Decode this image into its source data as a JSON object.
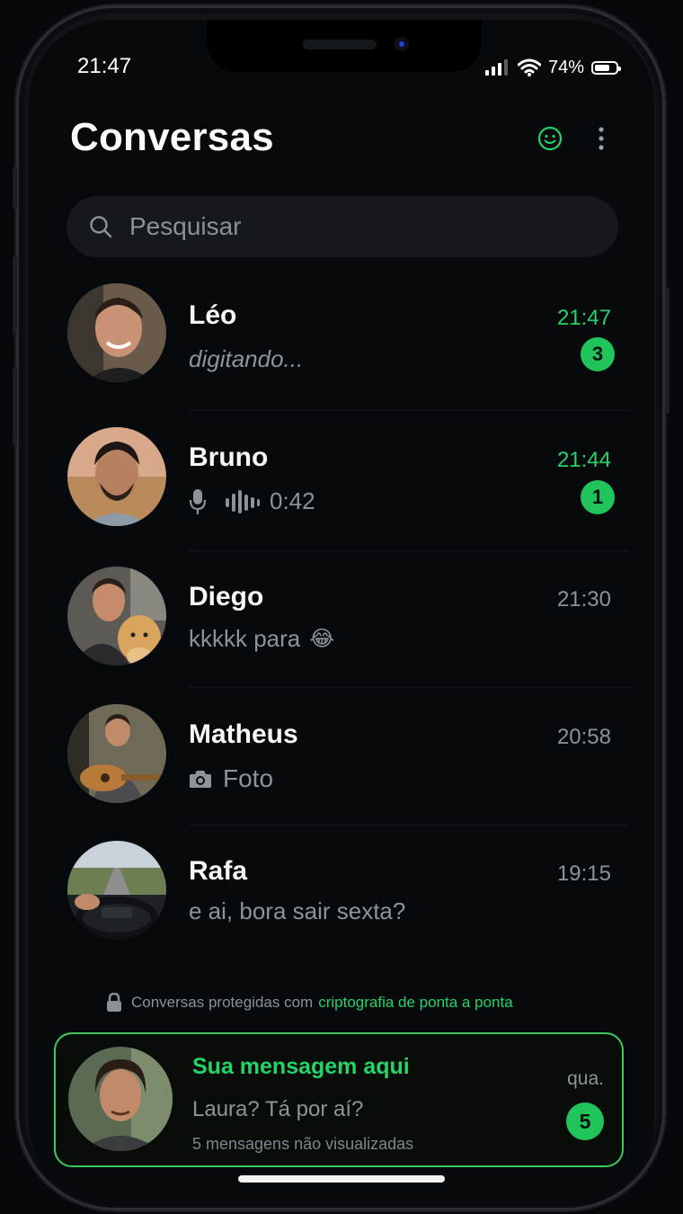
{
  "status_bar": {
    "time": "21:47",
    "battery_pct": "74%",
    "battery_level": 0.74
  },
  "header": {
    "title": "Conversas",
    "status_icon": "smiley-icon",
    "menu_icon": "kebab-menu-icon"
  },
  "search": {
    "placeholder": "Pesquisar"
  },
  "chats": [
    {
      "name": "Léo",
      "preview": "digitando...",
      "time": "21:47",
      "unread": "3"
    },
    {
      "name": "Bruno",
      "preview": "0:42",
      "time": "21:44",
      "unread": "1"
    },
    {
      "name": "Diego",
      "preview": "kkkkk para",
      "emoji": "😂",
      "time": "21:30"
    },
    {
      "name": "Matheus",
      "preview": "Foto",
      "time": "20:58"
    },
    {
      "name": "Rafa",
      "preview": "e ai, bora sair sexta?",
      "time": "19:15"
    }
  ],
  "encryption": {
    "prefix": "Conversas protegidas com",
    "highlight": "criptografia de ponta a ponta"
  },
  "promo": {
    "title": "Sua mensagem aqui",
    "message": "Laura? Tá por aí?",
    "subtitle": "5 mensagens não visualizadas",
    "time": "qua.",
    "unread": "5"
  },
  "colors": {
    "accent": "#25d366",
    "background": "#070a0d",
    "muted": "#8d9398"
  }
}
